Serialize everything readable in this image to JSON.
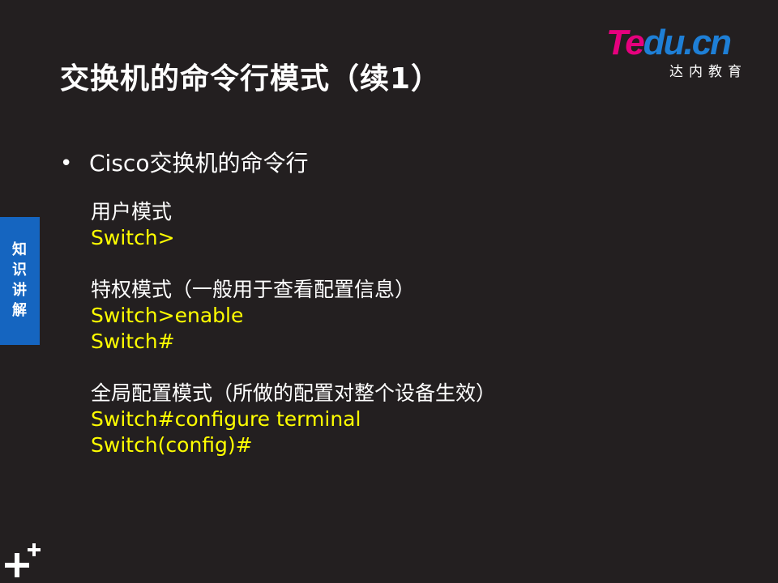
{
  "slide": {
    "title": "交换机的命令行模式（续1）",
    "side_tab": "知识讲解"
  },
  "logo": {
    "mark_part1": "Te",
    "mark_part2": "du.cn",
    "sub": "达内教育"
  },
  "bullet": {
    "symbol": "•",
    "text": "Cisco交换机的命令行"
  },
  "modes": {
    "user": {
      "heading": "用户模式",
      "prompt": "Switch>"
    },
    "privileged": {
      "heading": "特权模式（一般用于查看配置信息）",
      "cmd": "Switch>enable",
      "prompt": "Switch#"
    },
    "global": {
      "heading": "全局配置模式（所做的配置对整个设备生效）",
      "cmd": "Switch#configure terminal",
      "prompt": "Switch(config)#"
    }
  },
  "colors": {
    "background": "#231f20",
    "text": "#ffffff",
    "command": "#ffff00",
    "side_tab": "#1565c0",
    "logo_pink": "#e6007e",
    "logo_blue": "#1e7fd6"
  },
  "icons": {
    "corner": "plus-cluster-icon"
  }
}
